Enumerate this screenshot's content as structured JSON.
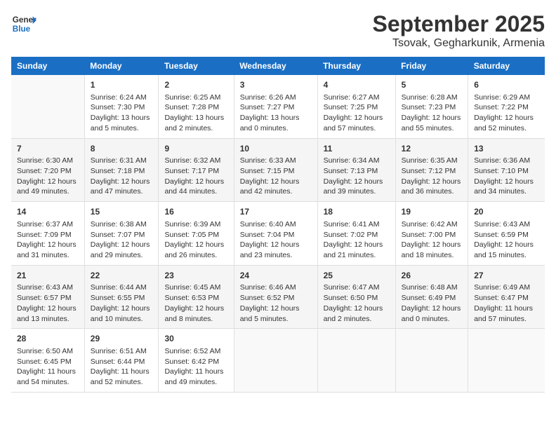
{
  "logo": {
    "line1": "General",
    "line2": "Blue"
  },
  "title": "September 2025",
  "location": "Tsovak, Gegharkunik, Armenia",
  "weekdays": [
    "Sunday",
    "Monday",
    "Tuesday",
    "Wednesday",
    "Thursday",
    "Friday",
    "Saturday"
  ],
  "weeks": [
    [
      {
        "day": "",
        "sunrise": "",
        "sunset": "",
        "daylight": ""
      },
      {
        "day": "1",
        "sunrise": "Sunrise: 6:24 AM",
        "sunset": "Sunset: 7:30 PM",
        "daylight": "Daylight: 13 hours and 5 minutes."
      },
      {
        "day": "2",
        "sunrise": "Sunrise: 6:25 AM",
        "sunset": "Sunset: 7:28 PM",
        "daylight": "Daylight: 13 hours and 2 minutes."
      },
      {
        "day": "3",
        "sunrise": "Sunrise: 6:26 AM",
        "sunset": "Sunset: 7:27 PM",
        "daylight": "Daylight: 13 hours and 0 minutes."
      },
      {
        "day": "4",
        "sunrise": "Sunrise: 6:27 AM",
        "sunset": "Sunset: 7:25 PM",
        "daylight": "Daylight: 12 hours and 57 minutes."
      },
      {
        "day": "5",
        "sunrise": "Sunrise: 6:28 AM",
        "sunset": "Sunset: 7:23 PM",
        "daylight": "Daylight: 12 hours and 55 minutes."
      },
      {
        "day": "6",
        "sunrise": "Sunrise: 6:29 AM",
        "sunset": "Sunset: 7:22 PM",
        "daylight": "Daylight: 12 hours and 52 minutes."
      }
    ],
    [
      {
        "day": "7",
        "sunrise": "Sunrise: 6:30 AM",
        "sunset": "Sunset: 7:20 PM",
        "daylight": "Daylight: 12 hours and 49 minutes."
      },
      {
        "day": "8",
        "sunrise": "Sunrise: 6:31 AM",
        "sunset": "Sunset: 7:18 PM",
        "daylight": "Daylight: 12 hours and 47 minutes."
      },
      {
        "day": "9",
        "sunrise": "Sunrise: 6:32 AM",
        "sunset": "Sunset: 7:17 PM",
        "daylight": "Daylight: 12 hours and 44 minutes."
      },
      {
        "day": "10",
        "sunrise": "Sunrise: 6:33 AM",
        "sunset": "Sunset: 7:15 PM",
        "daylight": "Daylight: 12 hours and 42 minutes."
      },
      {
        "day": "11",
        "sunrise": "Sunrise: 6:34 AM",
        "sunset": "Sunset: 7:13 PM",
        "daylight": "Daylight: 12 hours and 39 minutes."
      },
      {
        "day": "12",
        "sunrise": "Sunrise: 6:35 AM",
        "sunset": "Sunset: 7:12 PM",
        "daylight": "Daylight: 12 hours and 36 minutes."
      },
      {
        "day": "13",
        "sunrise": "Sunrise: 6:36 AM",
        "sunset": "Sunset: 7:10 PM",
        "daylight": "Daylight: 12 hours and 34 minutes."
      }
    ],
    [
      {
        "day": "14",
        "sunrise": "Sunrise: 6:37 AM",
        "sunset": "Sunset: 7:09 PM",
        "daylight": "Daylight: 12 hours and 31 minutes."
      },
      {
        "day": "15",
        "sunrise": "Sunrise: 6:38 AM",
        "sunset": "Sunset: 7:07 PM",
        "daylight": "Daylight: 12 hours and 29 minutes."
      },
      {
        "day": "16",
        "sunrise": "Sunrise: 6:39 AM",
        "sunset": "Sunset: 7:05 PM",
        "daylight": "Daylight: 12 hours and 26 minutes."
      },
      {
        "day": "17",
        "sunrise": "Sunrise: 6:40 AM",
        "sunset": "Sunset: 7:04 PM",
        "daylight": "Daylight: 12 hours and 23 minutes."
      },
      {
        "day": "18",
        "sunrise": "Sunrise: 6:41 AM",
        "sunset": "Sunset: 7:02 PM",
        "daylight": "Daylight: 12 hours and 21 minutes."
      },
      {
        "day": "19",
        "sunrise": "Sunrise: 6:42 AM",
        "sunset": "Sunset: 7:00 PM",
        "daylight": "Daylight: 12 hours and 18 minutes."
      },
      {
        "day": "20",
        "sunrise": "Sunrise: 6:43 AM",
        "sunset": "Sunset: 6:59 PM",
        "daylight": "Daylight: 12 hours and 15 minutes."
      }
    ],
    [
      {
        "day": "21",
        "sunrise": "Sunrise: 6:43 AM",
        "sunset": "Sunset: 6:57 PM",
        "daylight": "Daylight: 12 hours and 13 minutes."
      },
      {
        "day": "22",
        "sunrise": "Sunrise: 6:44 AM",
        "sunset": "Sunset: 6:55 PM",
        "daylight": "Daylight: 12 hours and 10 minutes."
      },
      {
        "day": "23",
        "sunrise": "Sunrise: 6:45 AM",
        "sunset": "Sunset: 6:53 PM",
        "daylight": "Daylight: 12 hours and 8 minutes."
      },
      {
        "day": "24",
        "sunrise": "Sunrise: 6:46 AM",
        "sunset": "Sunset: 6:52 PM",
        "daylight": "Daylight: 12 hours and 5 minutes."
      },
      {
        "day": "25",
        "sunrise": "Sunrise: 6:47 AM",
        "sunset": "Sunset: 6:50 PM",
        "daylight": "Daylight: 12 hours and 2 minutes."
      },
      {
        "day": "26",
        "sunrise": "Sunrise: 6:48 AM",
        "sunset": "Sunset: 6:49 PM",
        "daylight": "Daylight: 12 hours and 0 minutes."
      },
      {
        "day": "27",
        "sunrise": "Sunrise: 6:49 AM",
        "sunset": "Sunset: 6:47 PM",
        "daylight": "Daylight: 11 hours and 57 minutes."
      }
    ],
    [
      {
        "day": "28",
        "sunrise": "Sunrise: 6:50 AM",
        "sunset": "Sunset: 6:45 PM",
        "daylight": "Daylight: 11 hours and 54 minutes."
      },
      {
        "day": "29",
        "sunrise": "Sunrise: 6:51 AM",
        "sunset": "Sunset: 6:44 PM",
        "daylight": "Daylight: 11 hours and 52 minutes."
      },
      {
        "day": "30",
        "sunrise": "Sunrise: 6:52 AM",
        "sunset": "Sunset: 6:42 PM",
        "daylight": "Daylight: 11 hours and 49 minutes."
      },
      {
        "day": "",
        "sunrise": "",
        "sunset": "",
        "daylight": ""
      },
      {
        "day": "",
        "sunrise": "",
        "sunset": "",
        "daylight": ""
      },
      {
        "day": "",
        "sunrise": "",
        "sunset": "",
        "daylight": ""
      },
      {
        "day": "",
        "sunrise": "",
        "sunset": "",
        "daylight": ""
      }
    ]
  ]
}
